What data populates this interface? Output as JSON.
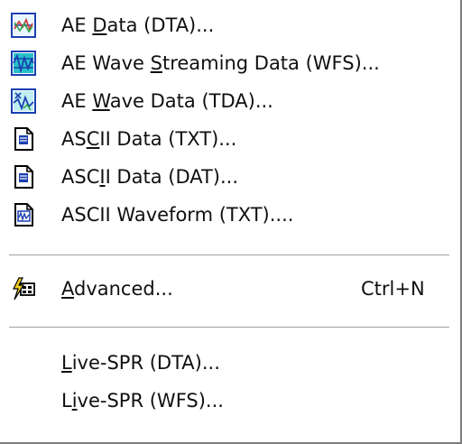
{
  "menu": {
    "items": [
      {
        "pre": "AE ",
        "u": "D",
        "post": "ata (DTA)...",
        "icon": "ae-data-icon"
      },
      {
        "pre": "AE Wave ",
        "u": "S",
        "post": "treaming Data (WFS)...",
        "icon": "ae-wave-streaming-icon"
      },
      {
        "pre": "AE ",
        "u": "W",
        "post": "ave Data (TDA)...",
        "icon": "ae-wave-data-icon"
      },
      {
        "pre": "AS",
        "u": "C",
        "post": "II Data (TXT)...",
        "icon": "document-icon"
      },
      {
        "pre": "ASC",
        "u": "I",
        "post": "I Data (DAT)...",
        "icon": "document-icon"
      },
      {
        "pre": "ASCII Waveform (TXT)....",
        "u": "",
        "post": "",
        "icon": "waveform-document-icon"
      },
      {
        "pre": "",
        "u": "A",
        "post": "dvanced...",
        "shortcut": "Ctrl+N",
        "icon": "advanced-icon"
      },
      {
        "pre": "",
        "u": "L",
        "post": "ive-SPR (DTA)..."
      },
      {
        "pre": "L",
        "u": "i",
        "post": "ve-SPR (WFS)..."
      }
    ]
  },
  "colors": {
    "text": "#101010",
    "separator": "#a0a0a0",
    "icon_blue": "#1a3fb0",
    "icon_cyan": "#27c0c8"
  }
}
